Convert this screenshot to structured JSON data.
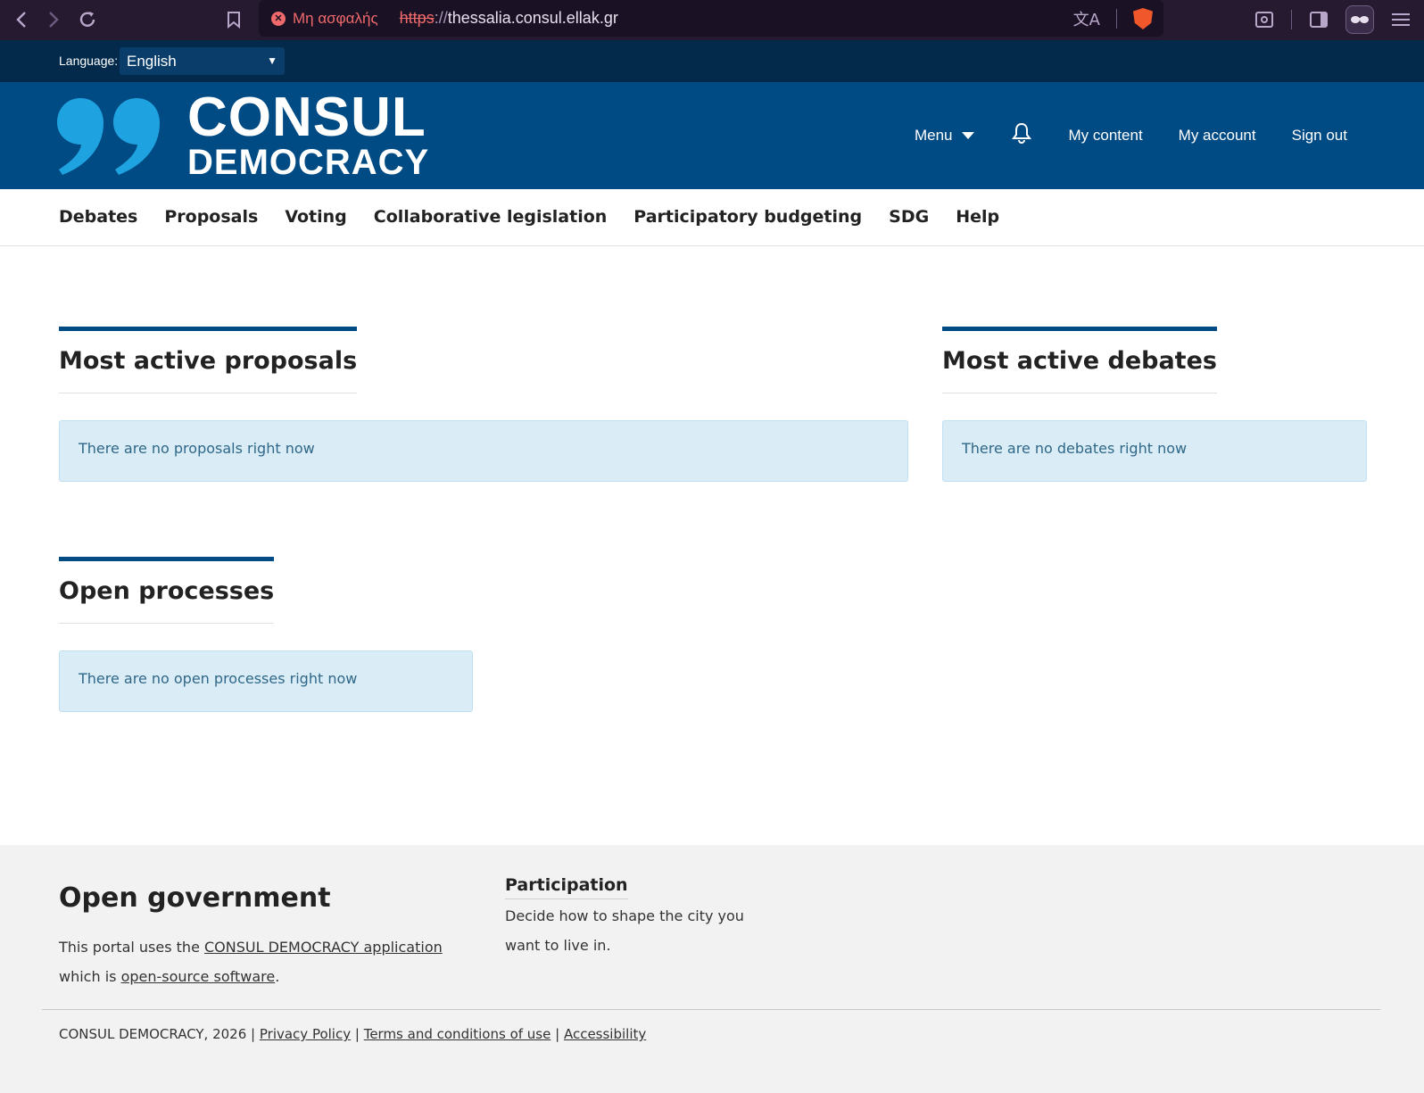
{
  "browser": {
    "insecure_label": "Μη ασφαλής",
    "url_proto": "https",
    "url_sep": "://",
    "url_host": "thessalia.consul.ellak.gr",
    "icons": [
      "back-icon",
      "forward-icon",
      "reload-icon",
      "bookmark-icon",
      "translate-icon",
      "brave-shield-icon",
      "screenshot-icon",
      "sidebar-icon",
      "private-glasses-icon",
      "hamburger-menu-icon"
    ]
  },
  "language": {
    "label": "Language:",
    "selected": "English"
  },
  "header": {
    "logo_line1": "CONSUL",
    "logo_line2": "DEMOCRACY",
    "menu_label": "Menu",
    "my_content": "My content",
    "my_account": "My account",
    "sign_out": "Sign out",
    "brand_color": "#004b84",
    "accent_color": "#1fa3e0"
  },
  "nav": {
    "items": [
      "Debates",
      "Proposals",
      "Voting",
      "Collaborative legislation",
      "Participatory budgeting",
      "SDG",
      "Help"
    ]
  },
  "main": {
    "proposals_title": "Most active proposals",
    "proposals_empty": "There are no proposals right now",
    "debates_title": "Most active debates",
    "debates_empty": "There are no debates right now",
    "processes_title": "Open processes",
    "processes_empty": "There are no open processes right now"
  },
  "footer": {
    "title": "Open government",
    "text_pre": "This portal uses the ",
    "link_app": "CONSUL DEMOCRACY application",
    "text_mid": " which is ",
    "link_oss": "open-source software",
    "text_post": ".",
    "participation_title": "Participation",
    "participation_text": "Decide how to shape the city you want to live in.",
    "copyright": "CONSUL DEMOCRACY, 2026 | ",
    "privacy": "Privacy Policy",
    "sep": " | ",
    "terms": "Terms and conditions of use",
    "accessibility": "Accessibility"
  }
}
